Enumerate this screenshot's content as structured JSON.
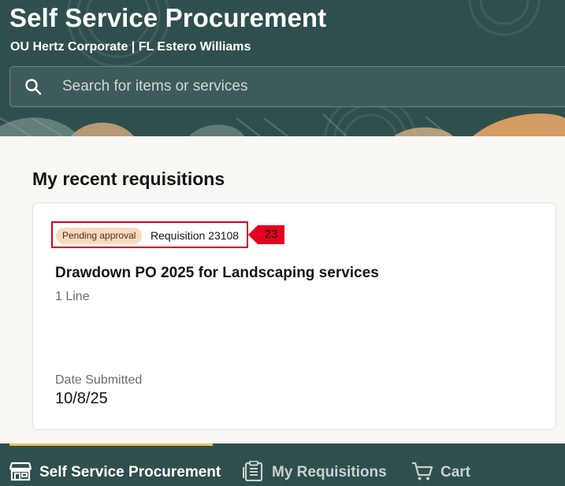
{
  "header": {
    "title": "Self Service Procurement",
    "org_line": "OU Hertz Corporate | FL Estero Williams",
    "search": {
      "placeholder": "Search for items or services",
      "value": "",
      "icon": "search-icon"
    }
  },
  "recent_requisitions": {
    "heading": "My recent requisitions",
    "items": [
      {
        "status": "Pending approval",
        "requisition_label": "Requisition 23108",
        "title": "Drawdown PO 2025 for Landscaping services",
        "lines": "1 Line",
        "date_label": "Date Submitted",
        "date_value": "10/8/25",
        "marker": "23"
      }
    ]
  },
  "bottom_nav": {
    "items": [
      {
        "label": "Self Service Procurement",
        "icon": "store-icon",
        "active": true
      },
      {
        "label": "My Requisitions",
        "icon": "clipboard-icon",
        "active": false
      },
      {
        "label": "Cart",
        "icon": "cart-icon",
        "active": false
      }
    ]
  },
  "colors": {
    "header_bg": "#2f4f4d",
    "status_badge_bg": "#f8d9be",
    "highlight_red": "#d9001b",
    "nav_indicator": "#e8c35a"
  }
}
